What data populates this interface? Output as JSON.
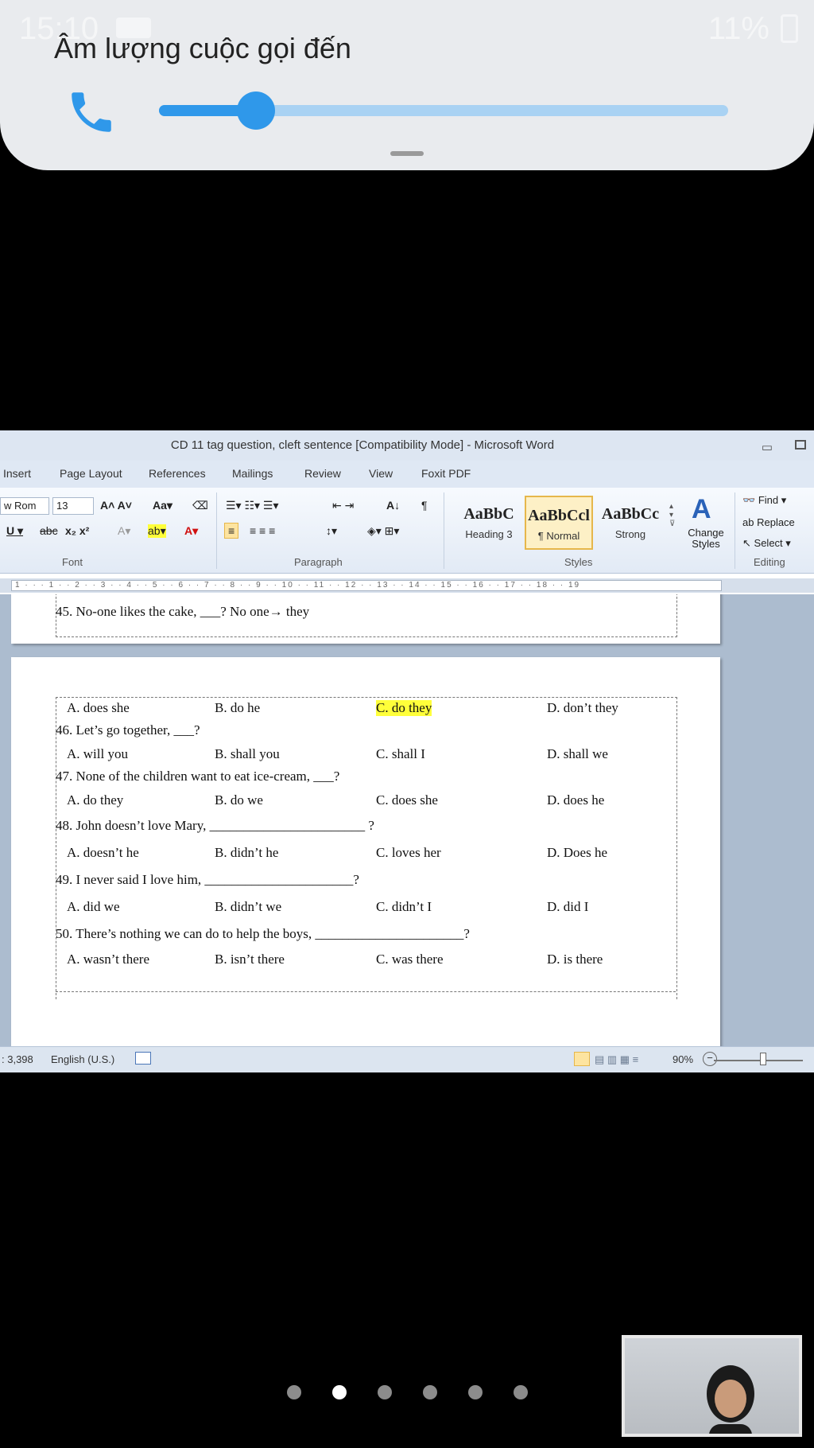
{
  "status_bar": {
    "time": "15:10",
    "battery": "11%"
  },
  "volume": {
    "title": "Âm lượng cuộc gọi đến",
    "level": 0.17,
    "icon": "phone-icon"
  },
  "word": {
    "title": "CD 11 tag question, cleft sentence [Compatibility Mode] - Microsoft Word",
    "tabs": [
      "Insert",
      "Page Layout",
      "References",
      "Mailings",
      "Review",
      "View",
      "Foxit PDF"
    ],
    "font": {
      "name": "w Rom",
      "size": "13"
    },
    "groups": {
      "font": "Font",
      "paragraph": "Paragraph",
      "styles": "Styles",
      "editing": "Editing"
    },
    "styles": [
      {
        "sample": "AaBbC",
        "name": "Heading 3"
      },
      {
        "sample": "AaBbCcl",
        "name": "¶ Normal"
      },
      {
        "sample": "AaBbCc",
        "name": "Strong"
      }
    ],
    "change_styles": "Change Styles",
    "editing": {
      "find": "Find",
      "replace": "Replace",
      "select": "Select"
    },
    "statusbar": {
      "words": ": 3,398",
      "language": "English (U.S.)",
      "zoom": "90%"
    }
  },
  "document": {
    "q45": "45. No-one likes the cake, ___? No one→ they",
    "questions": [
      {
        "options": [
          "A. does she",
          "B. do he",
          "C. do they",
          "D. don’t they"
        ],
        "highlight": 2
      },
      {
        "text": "46. Let’s go together, ___?",
        "options": [
          "A. will you",
          "B. shall you",
          "C. shall I",
          "D. shall we"
        ]
      },
      {
        "text": "47. None of the children want to eat ice-cream, ___?",
        "options": [
          "A. do they",
          "B. do we",
          "C. does she",
          "D. does he"
        ]
      },
      {
        "text": "48. John doesn’t love Mary, _______________________ ?",
        "options": [
          "A. doesn’t he",
          "B. didn’t he",
          "C. loves her",
          "D. Does he"
        ]
      },
      {
        "text": "49. I never said I love him, ______________________?",
        "options": [
          "A. did we",
          "B. didn’t we",
          "C. didn’t I",
          "D. did I"
        ]
      },
      {
        "text": "50. There’s nothing we can do to help the boys, ______________________?",
        "options": [
          "A. wasn’t there",
          "B. isn’t there",
          "C. was there",
          "D. is there"
        ]
      }
    ]
  },
  "pager": {
    "count": 6,
    "active": 1
  }
}
